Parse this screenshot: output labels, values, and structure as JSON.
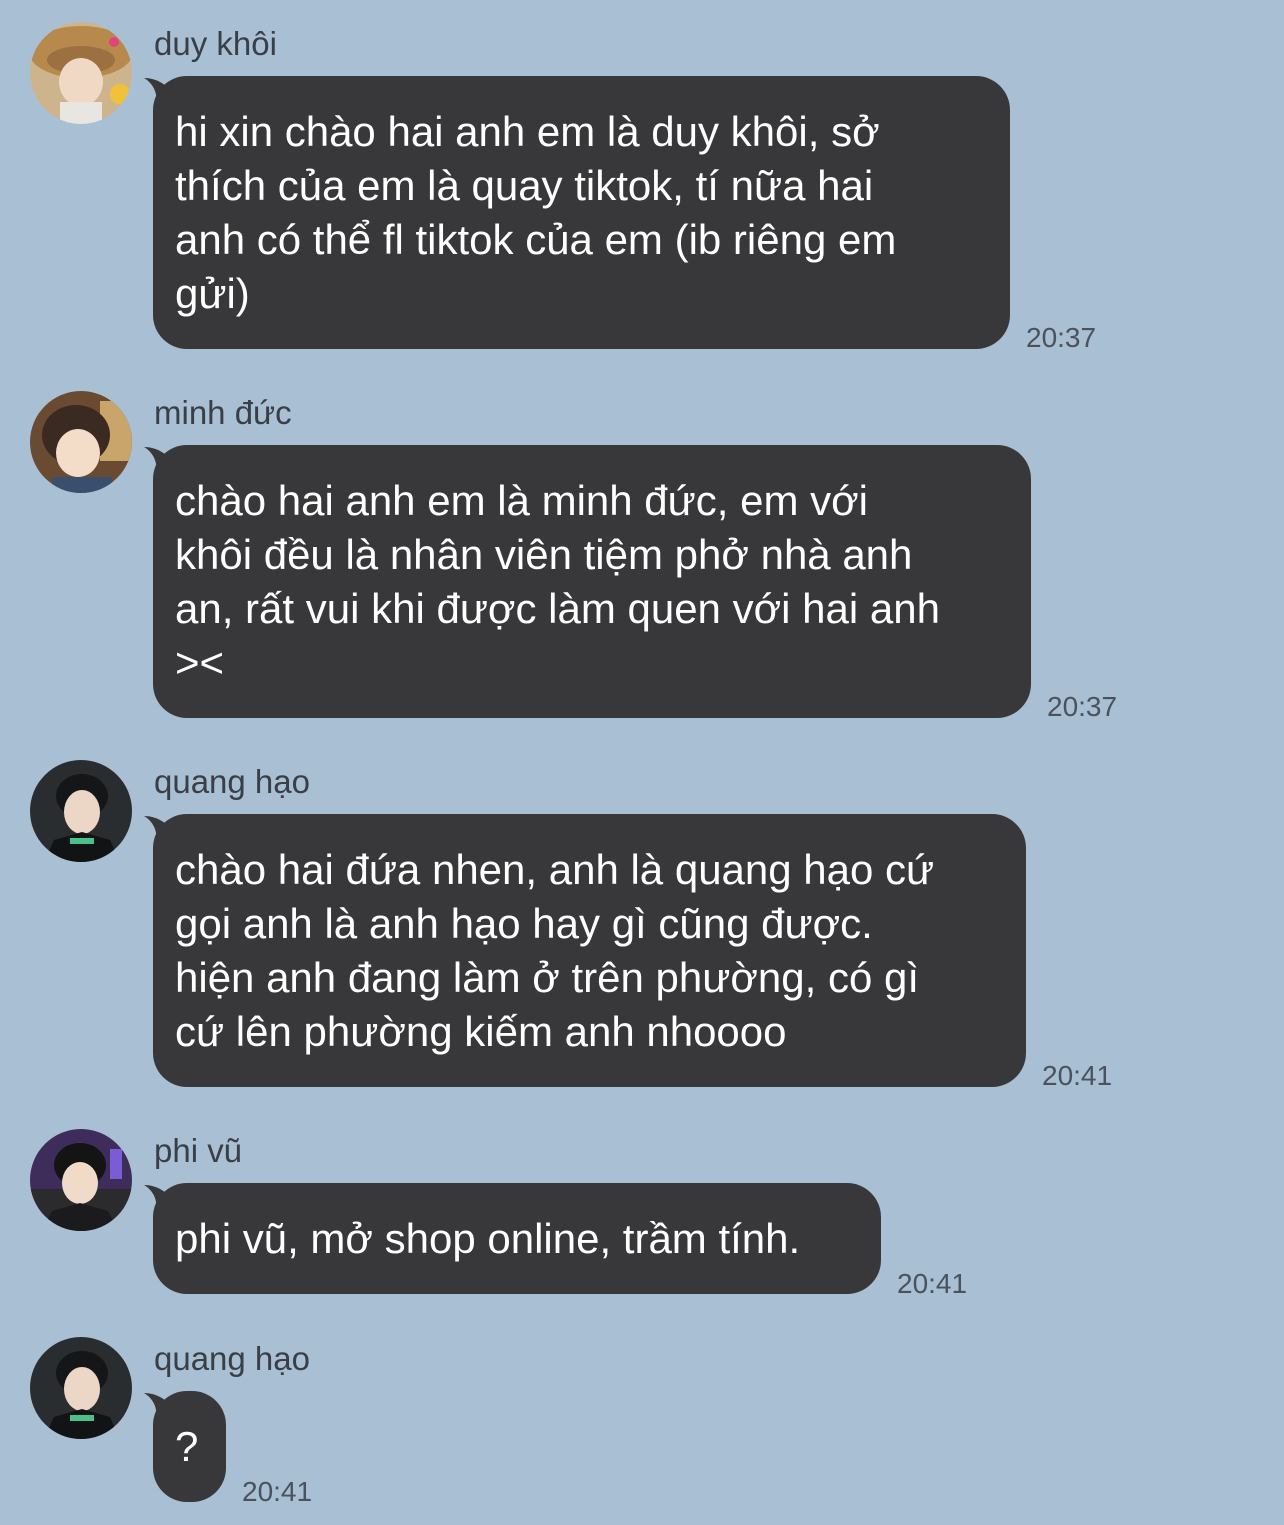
{
  "messages": [
    {
      "sender": "duy khôi",
      "avatar_icon": "user-avatar-straw-hat",
      "lines": [
        "hi xin chào hai anh em là duy khôi, sở",
        "thích của em là quay tiktok, tí nữa hai",
        "anh có thể fl tiktok của em (ib riêng em",
        "gửi)"
      ],
      "time": "20:37"
    },
    {
      "sender": "minh đức",
      "avatar_icon": "user-avatar-brown-hair",
      "lines": [
        "chào hai anh em là minh đức, em với",
        "khôi đều là nhân viên tiệm phở nhà anh",
        "an, rất vui khi được làm quen với hai anh",
        "><"
      ],
      "time": "20:37"
    },
    {
      "sender": "quang hạo",
      "avatar_icon": "user-avatar-dark-jacket",
      "lines": [
        "chào hai đứa nhen, anh là quang hạo cứ",
        "gọi anh là anh hạo hay gì cũng được.",
        "hiện anh đang làm ở trên phường, có gì",
        "cứ lên phường kiếm anh nhoooo"
      ],
      "time": "20:41"
    },
    {
      "sender": "phi vũ",
      "avatar_icon": "user-avatar-purple-bg",
      "lines": [
        "phi vũ, mở shop online, trầm tính."
      ],
      "time": "20:41"
    },
    {
      "sender": "quang hạo",
      "avatar_icon": "user-avatar-dark-jacket",
      "lines": [
        "?"
      ],
      "time": "20:41"
    }
  ],
  "colors": {
    "background": "#a9bfd3",
    "bubble": "#38383a",
    "bubble_text": "#ffffff",
    "name_text": "#3a3f47",
    "time_text": "#4b525c"
  }
}
